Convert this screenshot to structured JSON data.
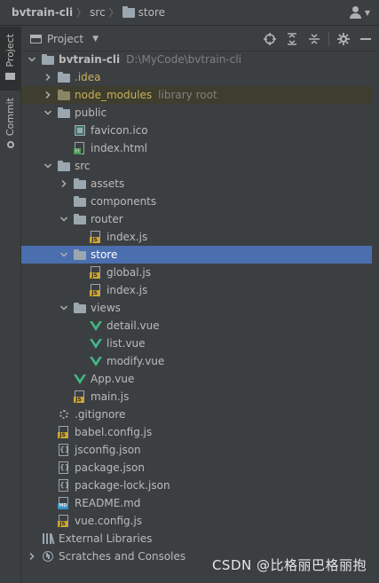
{
  "breadcrumb": [
    {
      "label": "bvtrain-cli",
      "icon": null
    },
    {
      "label": "src",
      "icon": null
    },
    {
      "label": "store",
      "icon": "folder-icon"
    }
  ],
  "side_tabs": [
    "Project",
    "Commit"
  ],
  "panel": {
    "title": "Project",
    "tools": [
      "locate-icon",
      "expand-all-icon",
      "collapse-all-icon",
      "gear-icon",
      "hide-icon"
    ]
  },
  "tree": [
    {
      "depth": 0,
      "arrow": "down",
      "icon": "folder",
      "label": "bvtrain-cli",
      "meta": "D:\\MyCode\\bvtrain-cli",
      "bold": true
    },
    {
      "depth": 1,
      "arrow": "right",
      "icon": "folder",
      "label": ".idea",
      "color": "idea"
    },
    {
      "depth": 1,
      "arrow": "right",
      "icon": "folder-excluded",
      "label": "node_modules",
      "meta": "library root",
      "color": "excluded",
      "highlight": "lib"
    },
    {
      "depth": 1,
      "arrow": "down",
      "icon": "folder",
      "label": "public"
    },
    {
      "depth": 2,
      "arrow": null,
      "icon": "ico",
      "label": "favicon.ico"
    },
    {
      "depth": 2,
      "arrow": null,
      "icon": "html",
      "label": "index.html"
    },
    {
      "depth": 1,
      "arrow": "down",
      "icon": "folder",
      "label": "src"
    },
    {
      "depth": 2,
      "arrow": "right",
      "icon": "folder",
      "label": "assets"
    },
    {
      "depth": 2,
      "arrow": null,
      "icon": "folder",
      "label": "components"
    },
    {
      "depth": 2,
      "arrow": "down",
      "icon": "folder",
      "label": "router"
    },
    {
      "depth": 3,
      "arrow": null,
      "icon": "js",
      "label": "index.js"
    },
    {
      "depth": 2,
      "arrow": "down",
      "icon": "folder",
      "label": "store",
      "selected": true
    },
    {
      "depth": 3,
      "arrow": null,
      "icon": "js",
      "label": "global.js"
    },
    {
      "depth": 3,
      "arrow": null,
      "icon": "js",
      "label": "index.js"
    },
    {
      "depth": 2,
      "arrow": "down",
      "icon": "folder",
      "label": "views"
    },
    {
      "depth": 3,
      "arrow": null,
      "icon": "vue",
      "label": "detail.vue"
    },
    {
      "depth": 3,
      "arrow": null,
      "icon": "vue",
      "label": "list.vue"
    },
    {
      "depth": 3,
      "arrow": null,
      "icon": "vue",
      "label": "modify.vue"
    },
    {
      "depth": 2,
      "arrow": null,
      "icon": "vue",
      "label": "App.vue"
    },
    {
      "depth": 2,
      "arrow": null,
      "icon": "js",
      "label": "main.js"
    },
    {
      "depth": 1,
      "arrow": null,
      "icon": "gear",
      "label": ".gitignore"
    },
    {
      "depth": 1,
      "arrow": null,
      "icon": "js",
      "label": "babel.config.js"
    },
    {
      "depth": 1,
      "arrow": null,
      "icon": "json",
      "label": "jsconfig.json"
    },
    {
      "depth": 1,
      "arrow": null,
      "icon": "json",
      "label": "package.json"
    },
    {
      "depth": 1,
      "arrow": null,
      "icon": "json",
      "label": "package-lock.json"
    },
    {
      "depth": 1,
      "arrow": null,
      "icon": "md",
      "label": "README.md"
    },
    {
      "depth": 1,
      "arrow": null,
      "icon": "js",
      "label": "vue.config.js"
    },
    {
      "depth": 0,
      "arrow": null,
      "icon": "libs",
      "label": "External Libraries"
    },
    {
      "depth": 0,
      "arrow": "right",
      "icon": "scratch",
      "label": "Scratches and Consoles"
    }
  ],
  "watermark": "CSDN @比格丽巴格丽抱",
  "colors": {
    "background": "#3c3f41",
    "selection": "#4b6eaf",
    "library_highlight": "#3e3d2e",
    "vue_green": "#41b883",
    "js_yellow": "#d0a52f"
  }
}
